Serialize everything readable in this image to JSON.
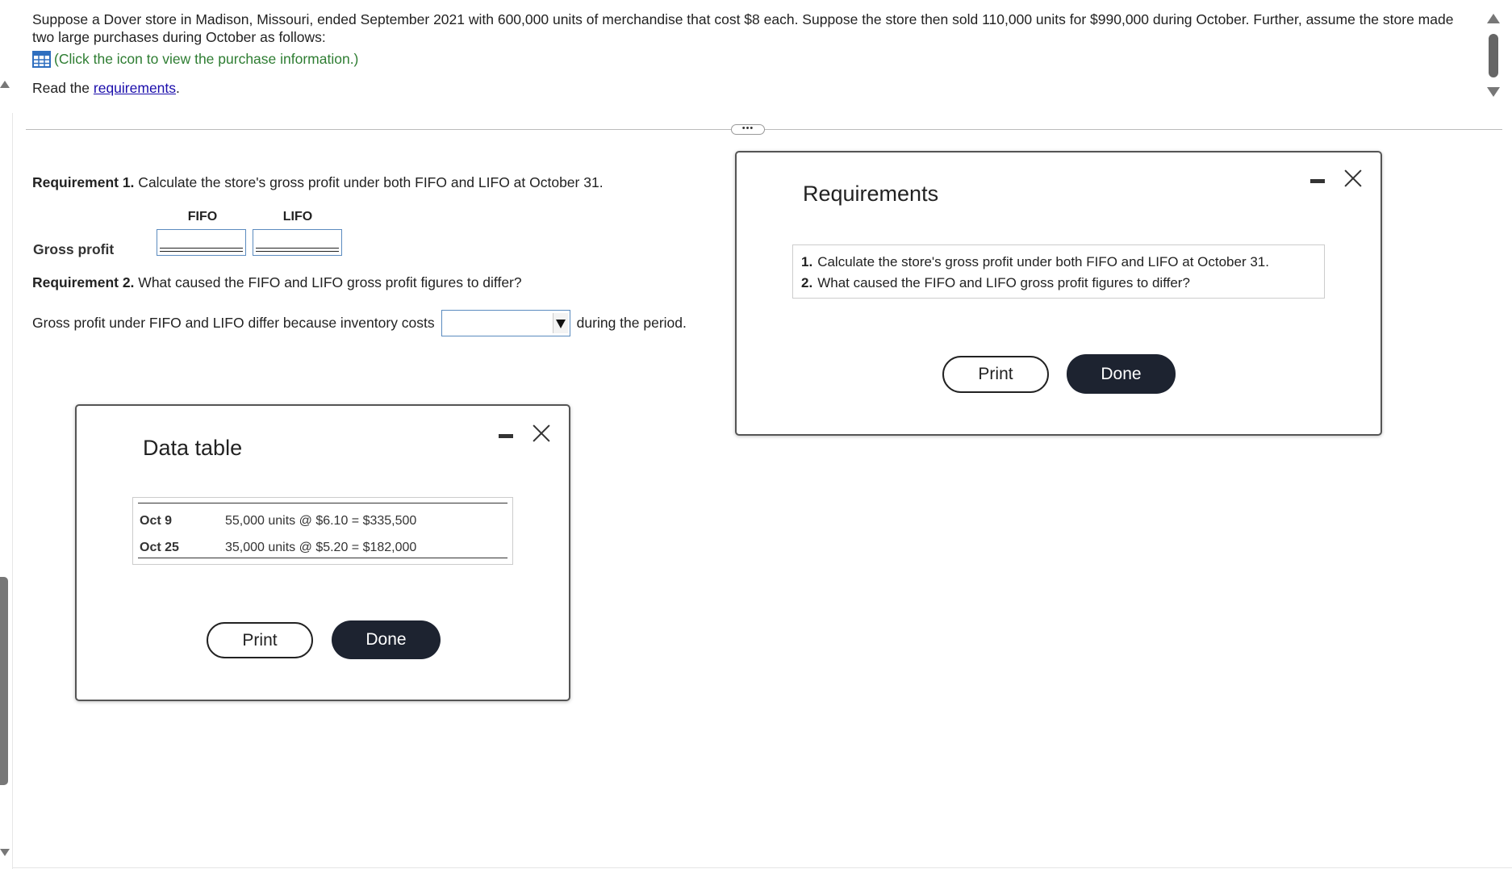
{
  "problem": {
    "text": "Suppose a Dover store in Madison, Missouri, ended September 2021 with 600,000 units of merchandise that cost $8 each. Suppose the store then sold 110,000 units for $990,000 during October. Further, assume the store made two large purchases during October as follows:",
    "data_link": "(Click the icon to view the purchase information.)",
    "read_prefix": "Read the ",
    "requirements_link": "requirements",
    "read_suffix": "."
  },
  "requirement1": {
    "label": "Requirement 1.",
    "text": " Calculate the store's gross profit under both FIFO and LIFO at October 31.",
    "col_fifo": "FIFO",
    "col_lifo": "LIFO",
    "row_label": "Gross profit"
  },
  "requirement2": {
    "label": "Requirement 2.",
    "text": " What caused the FIFO and LIFO gross profit figures to differ?",
    "sentence_before": "Gross profit under FIFO and LIFO differ because inventory costs",
    "sentence_after": "during the period.",
    "selected": ""
  },
  "data_dialog": {
    "title": "Data table",
    "rows": [
      {
        "date": "Oct 9",
        "value": "55,000 units @ $6.10 = $335,500"
      },
      {
        "date": "Oct 25",
        "value": "35,000 units @ $5.20 = $182,000"
      }
    ],
    "print": "Print",
    "done": "Done"
  },
  "req_dialog": {
    "title": "Requirements",
    "items": [
      {
        "num": "1.",
        "text": "Calculate the store's gross profit under both FIFO and LIFO at October 31."
      },
      {
        "num": "2.",
        "text": "What caused the FIFO and LIFO gross profit figures to differ?"
      }
    ],
    "print": "Print",
    "done": "Done"
  },
  "divider_handle": "•••",
  "colors": {
    "link_green": "#2e7d32",
    "link_blue": "#1a0dab",
    "done_button": "#1d2330",
    "input_border": "#5b8bbf"
  }
}
